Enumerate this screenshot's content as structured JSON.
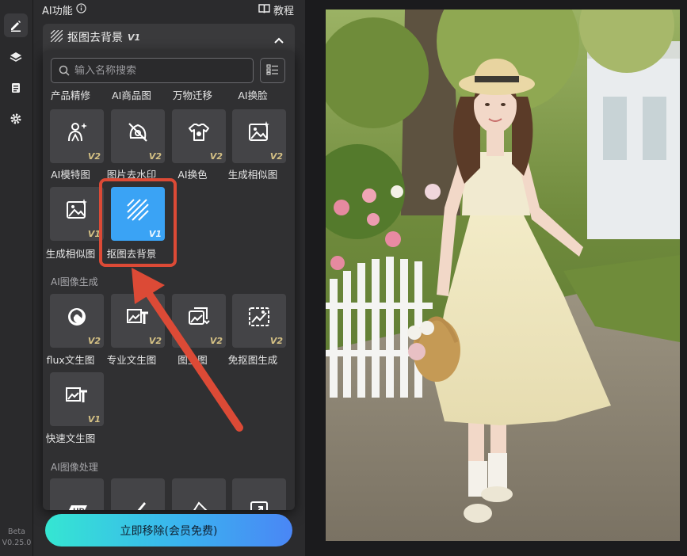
{
  "rail": {
    "icons": [
      "edit-icon",
      "layers-icon",
      "document-icon",
      "settings-icon"
    ],
    "beta": "Beta",
    "version": "V0.25.0"
  },
  "panel": {
    "ai_title": "AI功能",
    "tutorial": "教程",
    "feature_name": "抠图去背景",
    "feature_version": "V1",
    "search_placeholder": "输入名称搜索",
    "top_row": [
      "产品精修",
      "AI商品图",
      "万物迁移",
      "AI换脸"
    ],
    "section1": [
      {
        "label": "AI模特图",
        "badge": "V2",
        "icon": "model-icon"
      },
      {
        "label": "图片去水印",
        "badge": "V2",
        "icon": "watermark-remove-icon"
      },
      {
        "label": "AI换色",
        "badge": "V2",
        "icon": "shirt-icon"
      },
      {
        "label": "生成相似图",
        "badge": "V2",
        "icon": "image-star-icon"
      },
      {
        "label": "生成相似图",
        "badge": "V1",
        "icon": "image-star-icon"
      },
      {
        "label": "抠图去背景",
        "badge": "V1",
        "icon": "hatch-icon"
      }
    ],
    "section2_title": "AI图像生成",
    "section2": [
      {
        "label": "flux文生图",
        "badge": "V2",
        "icon": "swirl-icon"
      },
      {
        "label": "专业文生图",
        "badge": "V2",
        "icon": "image-text-icon"
      },
      {
        "label": "图生图",
        "badge": "V2",
        "icon": "image-swap-icon"
      },
      {
        "label": "免抠图生成",
        "badge": "V2",
        "icon": "image-crop-icon"
      },
      {
        "label": "快速文生图",
        "badge": "V1",
        "icon": "image-text-icon"
      }
    ],
    "section3_title": "AI图像处理",
    "section3": [
      {
        "label": "",
        "icon": "hd-icon"
      },
      {
        "label": "",
        "icon": "brush-icon"
      },
      {
        "label": "",
        "icon": "eraser-icon"
      },
      {
        "label": "",
        "icon": "expand-icon"
      }
    ],
    "cta": "立即移除(会员免费)"
  },
  "colors": {
    "accent": "#3aa3f5",
    "highlight": "#dc4a36",
    "badge": "#d4c084"
  }
}
